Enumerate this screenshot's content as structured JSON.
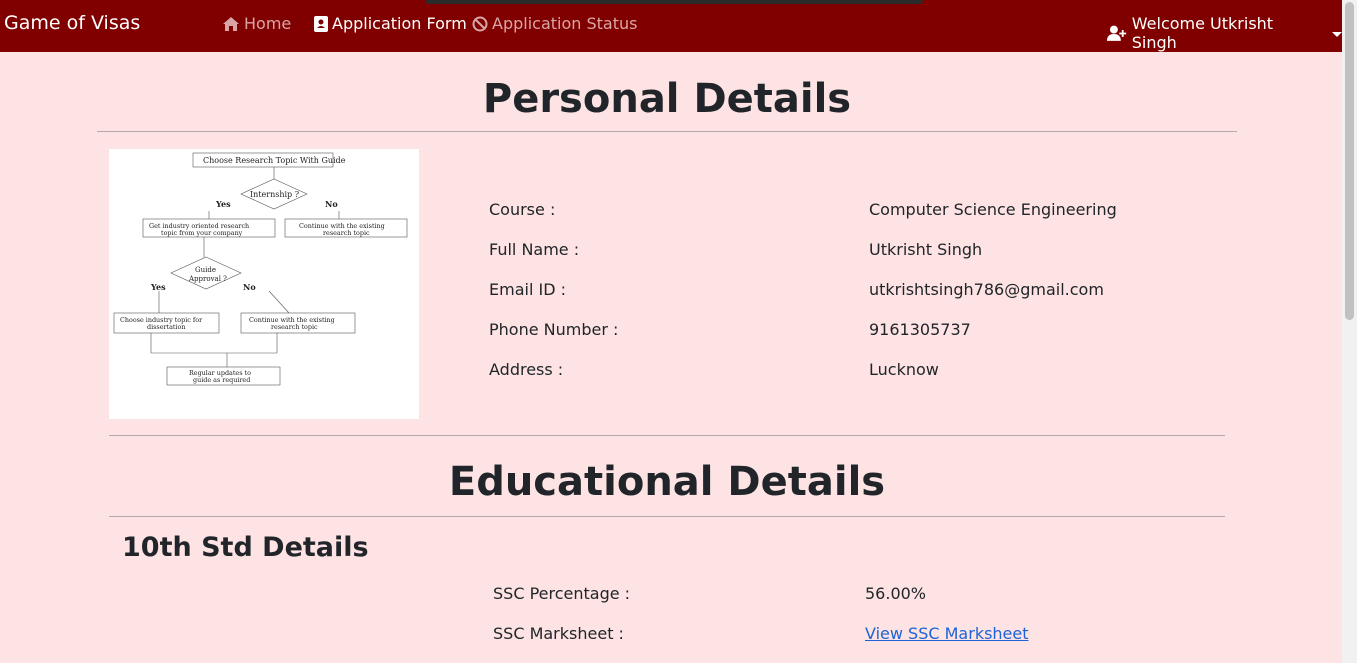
{
  "nav": {
    "brand": "Game of Visas",
    "home": "Home",
    "application_form": "Application Form",
    "application_status": "Application Status",
    "user_menu": "Welcome Utkrisht Singh"
  },
  "personal": {
    "title": "Personal Details",
    "photo_flowchart": {
      "title": "Choose Research Topic With Guide",
      "decision1": "Internship ?",
      "yes1": "Yes",
      "no1": "No",
      "box_left1": "Get industry oriented research topic from your company",
      "box_right1": "Continue with the existing research topic",
      "decision2_line1": "Guide",
      "decision2_line2": "Approval ?",
      "yes2": "Yes",
      "no2": "No",
      "box_left2": "Choose industry topic for dissertation",
      "box_right2": "Continue with the existing research topic",
      "final": "Regular updates to guide as required"
    },
    "fields": [
      {
        "label": "Course :",
        "value": "Computer Science Engineering"
      },
      {
        "label": "Full Name :",
        "value": "Utkrisht Singh"
      },
      {
        "label": "Email ID :",
        "value": "utkrishtsingh786@gmail.com"
      },
      {
        "label": "Phone Number :",
        "value": "9161305737"
      },
      {
        "label": "Address :",
        "value": "Lucknow"
      }
    ]
  },
  "education": {
    "title": "Educational Details",
    "tenth": {
      "title": "10th Std Details",
      "percentage_label": "SSC Percentage :",
      "percentage_value": "56.00%",
      "marksheet_label": "SSC Marksheet :",
      "marksheet_link": "View SSC Marksheet"
    }
  },
  "colors": {
    "navbar": "#800000",
    "background": "#fde3e3",
    "link": "#1e63d6"
  }
}
